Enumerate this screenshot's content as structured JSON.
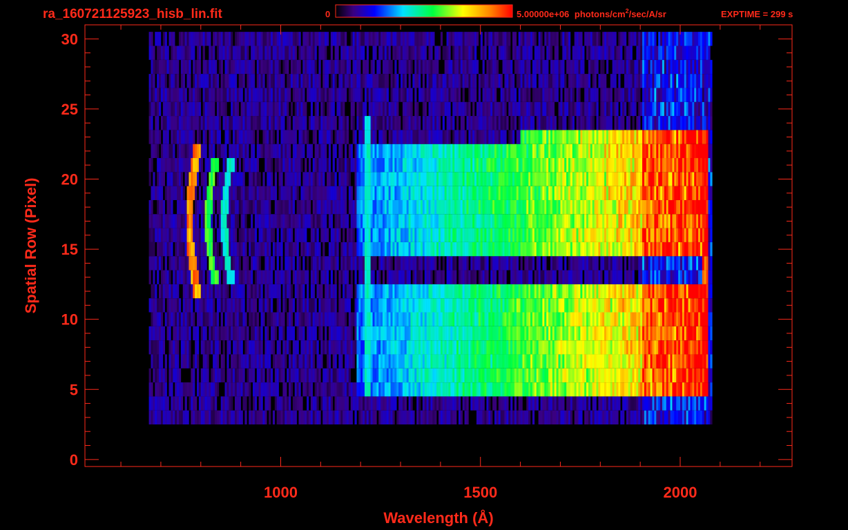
{
  "header": {
    "filename": "ra_160721125923_hisb_lin.fit",
    "colorbar_min": "0",
    "colorbar_max": "5.00000e+06",
    "units_prefix": "photons/cm",
    "units_exp": "2",
    "units_suffix": "/sec/A/sr",
    "exptime": "EXPTIME = 299 s"
  },
  "colors": {
    "axis": "#ff2a1a",
    "background": "#000000"
  },
  "chart_data": {
    "type": "heatmap",
    "title": "ra_160721125923_hisb_lin.fit",
    "xlabel": "Wavelength (Å)",
    "ylabel": "Spatial Row (Pixel)",
    "xlim": [
      510,
      2280
    ],
    "ylim": [
      -0.5,
      31
    ],
    "x_ticks": [
      1000,
      1500,
      2000
    ],
    "y_ticks": [
      0,
      5,
      10,
      15,
      20,
      25,
      30
    ],
    "colorbar": {
      "min": 0,
      "max": 5000000,
      "colormap": "rainbow"
    },
    "rows": [
      0,
      1,
      2,
      3,
      4,
      5,
      6,
      7,
      8,
      9,
      10,
      11,
      12,
      13,
      14,
      15,
      16,
      17,
      18,
      19,
      20,
      21,
      22,
      23,
      24,
      25,
      26,
      27,
      28,
      29,
      30
    ],
    "features": [
      {
        "label": "continuum",
        "wl_start": 1190,
        "wl_end": 2065,
        "rows": [
          5,
          23
        ],
        "peak_level": 0.8
      },
      {
        "label": "line",
        "wl_center": 1215,
        "rows": [
          5,
          24
        ],
        "level": 0.45
      },
      {
        "label": "arc",
        "wl_center": 770,
        "rows": [
          12,
          22
        ],
        "level": 0.9
      },
      {
        "label": "arc",
        "wl_center": 815,
        "rows": [
          13,
          21
        ],
        "level": 0.6
      },
      {
        "label": "arc",
        "wl_center": 855,
        "rows": [
          13,
          21
        ],
        "level": 0.45
      },
      {
        "label": "edge",
        "wl_center": 2060,
        "rows": [
          5,
          22
        ],
        "level": 1.0
      }
    ]
  }
}
